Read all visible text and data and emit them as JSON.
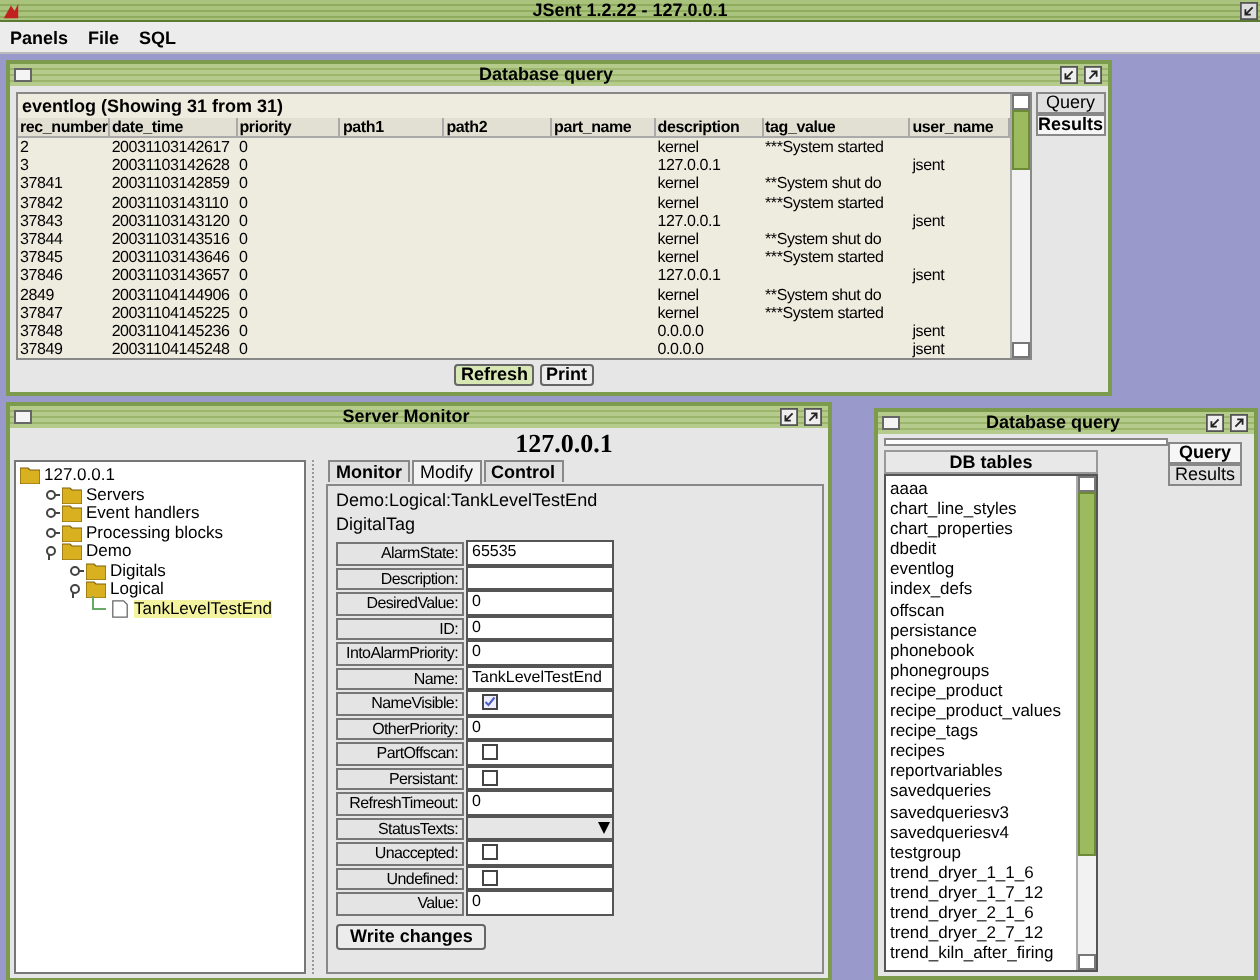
{
  "window": {
    "title": "JSent 1.2.22 - 127.0.0.1"
  },
  "menu": [
    "Panels",
    "File",
    "SQL"
  ],
  "query_window": {
    "title": "Database query",
    "table_title": "eventlog (Showing 31 from 31)",
    "columns": [
      "rec_number",
      "date_time",
      "priority",
      "path1",
      "path2",
      "part_name",
      "description",
      "tag_value",
      "user_name"
    ],
    "rows": [
      {
        "rec_number": "2",
        "date_time": "20031103142617",
        "priority": "0",
        "description": "kernel",
        "tag_value": "***System started"
      },
      {
        "rec_number": "3",
        "date_time": "20031103142628",
        "priority": "0",
        "description": "127.0.0.1",
        "user_name": "jsent"
      },
      {
        "rec_number": "37841",
        "date_time": "20031103142859",
        "priority": "0",
        "description": "kernel",
        "tag_value": "**System shut do"
      },
      {
        "rec_number": "37842",
        "date_time": "20031103143110",
        "priority": "0",
        "description": "kernel",
        "tag_value": "***System started"
      },
      {
        "rec_number": "37843",
        "date_time": "20031103143120",
        "priority": "0",
        "description": "127.0.0.1",
        "user_name": "jsent"
      },
      {
        "rec_number": "37844",
        "date_time": "20031103143516",
        "priority": "0",
        "description": "kernel",
        "tag_value": "**System shut do"
      },
      {
        "rec_number": "37845",
        "date_time": "20031103143646",
        "priority": "0",
        "description": "kernel",
        "tag_value": "***System started"
      },
      {
        "rec_number": "37846",
        "date_time": "20031103143657",
        "priority": "0",
        "description": "127.0.0.1",
        "user_name": "jsent"
      },
      {
        "rec_number": "2849",
        "date_time": "20031104144906",
        "priority": "0",
        "description": "kernel",
        "tag_value": "**System shut do"
      },
      {
        "rec_number": "37847",
        "date_time": "20031104145225",
        "priority": "0",
        "description": "kernel",
        "tag_value": "***System started"
      },
      {
        "rec_number": "37848",
        "date_time": "20031104145236",
        "priority": "0",
        "description": "0.0.0.0",
        "user_name": "jsent"
      },
      {
        "rec_number": "37849",
        "date_time": "20031104145248",
        "priority": "0",
        "description": "0.0.0.0",
        "user_name": "jsent"
      }
    ],
    "buttons": [
      "Refresh",
      "Print"
    ],
    "side_tabs": [
      {
        "label": "Query",
        "selected": false
      },
      {
        "label": "Results",
        "selected": true
      }
    ]
  },
  "server_monitor": {
    "title": "Server Monitor",
    "heading": "127.0.0.1",
    "tree": [
      {
        "label": "127.0.0.1",
        "selected": false,
        "children": [
          {
            "label": "Servers",
            "expanded": false,
            "selected": false
          },
          {
            "label": "Event handlers",
            "expanded": false,
            "selected": false
          },
          {
            "label": "Processing blocks",
            "expanded": false,
            "selected": false
          },
          {
            "label": "Demo",
            "expanded": true,
            "selected": false,
            "children": [
              {
                "label": "Digitals",
                "expanded": false,
                "selected": false
              },
              {
                "label": "Logical",
                "expanded": true,
                "selected": false,
                "children": [
                  {
                    "label": "TankLevelTestEnd",
                    "kind": "leaf",
                    "selected": true
                  }
                ]
              }
            ]
          }
        ]
      }
    ],
    "tabs": [
      {
        "label": "Monitor",
        "selected": false
      },
      {
        "label": "Modify",
        "selected": true
      },
      {
        "label": "Control",
        "selected": false
      }
    ],
    "path": "Demo:Logical:TankLevelTestEnd",
    "type": "DigitalTag",
    "fields": [
      {
        "label": "AlarmState:",
        "kind": "text",
        "value": "65535"
      },
      {
        "label": "Description:",
        "kind": "text"
      },
      {
        "label": "DesiredValue:",
        "kind": "text",
        "value": "0"
      },
      {
        "label": "ID:",
        "kind": "text",
        "value": "0"
      },
      {
        "label": "IntoAlarmPriority:",
        "kind": "text",
        "value": "0"
      },
      {
        "label": "Name:",
        "kind": "text",
        "value": "TankLevelTestEnd"
      },
      {
        "label": "NameVisible:",
        "kind": "checkbox",
        "checked": true
      },
      {
        "label": "OtherPriority:",
        "kind": "text",
        "value": "0"
      },
      {
        "label": "PartOffscan:",
        "kind": "checkbox",
        "checked": false
      },
      {
        "label": "Persistant:",
        "kind": "checkbox",
        "checked": false
      },
      {
        "label": "RefreshTimeout:",
        "kind": "text",
        "value": "0"
      },
      {
        "label": "StatusTexts:",
        "kind": "select"
      },
      {
        "label": "Unaccepted:",
        "kind": "checkbox",
        "checked": false
      },
      {
        "label": "Undefined:",
        "kind": "checkbox",
        "checked": false
      },
      {
        "label": "Value:",
        "kind": "text",
        "value": "0"
      }
    ],
    "write_button": "Write changes"
  },
  "tables_window": {
    "title": "Database query",
    "list_header": "DB tables",
    "tables": [
      "aaaa",
      "chart_line_styles",
      "chart_properties",
      "dbedit",
      "eventlog",
      "index_defs",
      "offscan",
      "persistance",
      "phonebook",
      "phonegroups",
      "recipe_product",
      "recipe_product_values",
      "recipe_tags",
      "recipes",
      "reportvariables",
      "savedqueries",
      "savedqueriesv3",
      "savedqueriesv4",
      "testgroup",
      "trend_dryer_1_1_6",
      "trend_dryer_1_7_12",
      "trend_dryer_2_1_6",
      "trend_dryer_2_7_12",
      "trend_kiln_after_firing"
    ],
    "side_tabs": [
      {
        "label": "Query",
        "selected": true
      },
      {
        "label": "Results",
        "selected": false
      }
    ]
  }
}
